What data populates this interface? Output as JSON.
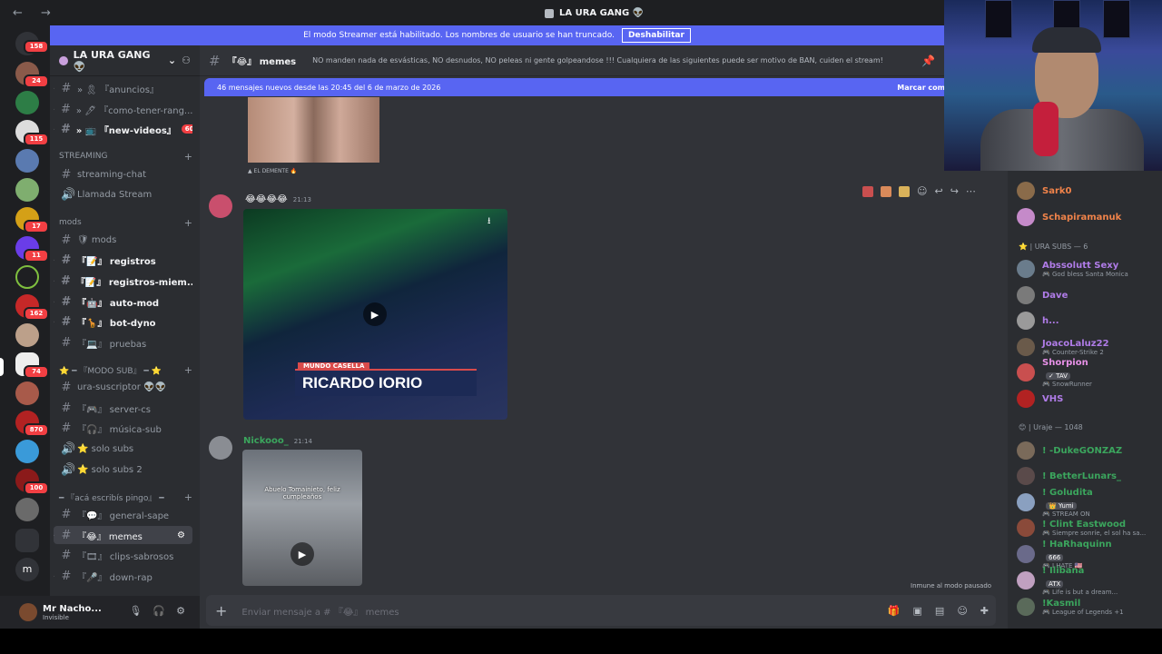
{
  "window": {
    "nav": "← →",
    "title": "LA URA GANG 👽"
  },
  "banner": {
    "text": "El modo Streamer está habilitado. Los nombres de usuario se han truncado.",
    "button": "Deshabilitar"
  },
  "guilds": {
    "badges": [
      "158",
      "24",
      "115",
      "17",
      "11",
      "162",
      "74",
      "870",
      "100"
    ]
  },
  "server": {
    "name": "LA URA GANG 👽"
  },
  "sidebar": {
    "channels": [
      {
        "label": "» 🎗 『anuncios』",
        "icon": "hash-icon"
      },
      {
        "label": "» 🖊 『como-tener-rang...",
        "icon": "hash-icon"
      },
      {
        "label": "» 📺 『new-videos』",
        "icon": "hash-icon",
        "mention": "60"
      },
      {
        "label": "streaming-chat",
        "icon": "hash-icon"
      },
      {
        "label": "Llamada Stream",
        "icon": "speaker-icon"
      },
      {
        "label": "🛡 mods",
        "icon": "hash-icon"
      },
      {
        "label": "『📝』 registros",
        "icon": "hash-icon"
      },
      {
        "label": "『📝』 registros-miem...",
        "icon": "hash-icon"
      },
      {
        "label": "『🤖』 auto-mod",
        "icon": "hash-icon"
      },
      {
        "label": "『🦒』 bot-dyno",
        "icon": "hash-icon"
      },
      {
        "label": "『💻』 pruebas",
        "icon": "hash-icon"
      },
      {
        "label": "ura-suscriptor 👽👽",
        "icon": "hash-icon"
      },
      {
        "label": "『🎮』 server-cs",
        "icon": "hash-icon"
      },
      {
        "label": "『🎧』 música-sub",
        "icon": "hash-icon"
      },
      {
        "label": "⭐ solo subs",
        "icon": "speaker-icon"
      },
      {
        "label": "⭐ solo subs 2",
        "icon": "speaker-icon"
      },
      {
        "label": "『💬』 general-sape",
        "icon": "hash-icon"
      },
      {
        "label": "『😂』 memes",
        "icon": "hash-icon"
      },
      {
        "label": "『🎞』 clips-sabrosos",
        "icon": "hash-icon"
      },
      {
        "label": "『🎤』 down-rap",
        "icon": "hash-icon"
      }
    ],
    "categories": [
      "STREAMING",
      "mods",
      "⭐ ━ 『MODO SUB』 ━ ⭐",
      "━ 『acá escribís pingo』 ━"
    ]
  },
  "user": {
    "name": "Mr Nacho...",
    "status": "Invisible"
  },
  "channel": {
    "name": "『😂』 memes",
    "topic": "NO manden nada de esvásticas, NO desnudos, NO peleas ni gente golpeandose !!! Cualquiera de las siguientes puede ser motivo de BAN, cuiden el stream!"
  },
  "newbar": {
    "text": "46 mensajes nuevos desde las 20:45 del 6 de marzo de 2026",
    "mark": "Marcar com"
  },
  "messages": [
    {
      "caption": "▲ EL DEMENTE 🔥"
    },
    {
      "author": "😂😂😂😂",
      "time": "21:13",
      "chyron_top": "MUNDO CASELLA",
      "chyron": "RICARDO IORIO"
    },
    {
      "author": "Nickooo_",
      "time": "21:14",
      "video_caption": "Abuelo Tomainieto, feliz cumpleaños"
    }
  ],
  "immune": "Inmune al modo pausado",
  "composer": {
    "placeholder": "Enviar mensaje a # 『😂』 memes"
  },
  "members": {
    "top": [
      {
        "name": "Sark0",
        "color": "#f0834a"
      },
      {
        "name": "Schapiramanuk",
        "color": "#f0834a"
      }
    ],
    "group1": "⭐ | URA SUBS — 6",
    "subs": [
      {
        "name": "Abssolutt Sexy",
        "sub": "🎮 God bless Santa Monica",
        "color": "#b07ce8"
      },
      {
        "name": "Dave",
        "sub": "",
        "color": "#b07ce8"
      },
      {
        "name": "h...",
        "sub": "",
        "color": "#b07ce8"
      },
      {
        "name": "JoacoLaluz22",
        "sub": "🎮 Counter-Strike 2",
        "color": "#b07ce8"
      },
      {
        "name": "Shorpion",
        "tag": "✓ TAV",
        "sub": "🎮 SnowRunner",
        "color": "#e891e8"
      },
      {
        "name": "VHS",
        "sub": "",
        "color": "#b07ce8"
      }
    ],
    "group2": "😊 | Uraje — 1048",
    "uraje": [
      {
        "name": "! -DukeGONZAZ",
        "sub": "",
        "color": "#3ba55d"
      },
      {
        "name": "! BetterLunars_",
        "sub": "",
        "color": "#3ba55d"
      },
      {
        "name": "! Goludita",
        "tag": "👑 Yumi",
        "sub": "🎮 STREAM ON",
        "color": "#3ba55d"
      },
      {
        "name": "! Clint Eastwood",
        "sub": "🎮 Siempre sonríe, el sol ha sa...",
        "color": "#3ba55d"
      },
      {
        "name": "! HaRhaquinn",
        "tag": "666",
        "sub": "🎮 I HATE 🇺🇸",
        "color": "#3ba55d"
      },
      {
        "name": "! Ilibana",
        "tag": "ATX",
        "sub": "🎮 Life is but a dream...",
        "color": "#3ba55d"
      },
      {
        "name": "!Kasmil",
        "sub": "🎮 League of Legends +1",
        "color": "#3ba55d"
      }
    ]
  },
  "colors": {
    "accent": "#5865f2",
    "mention": "#f23f43",
    "online": "#23a55a"
  }
}
